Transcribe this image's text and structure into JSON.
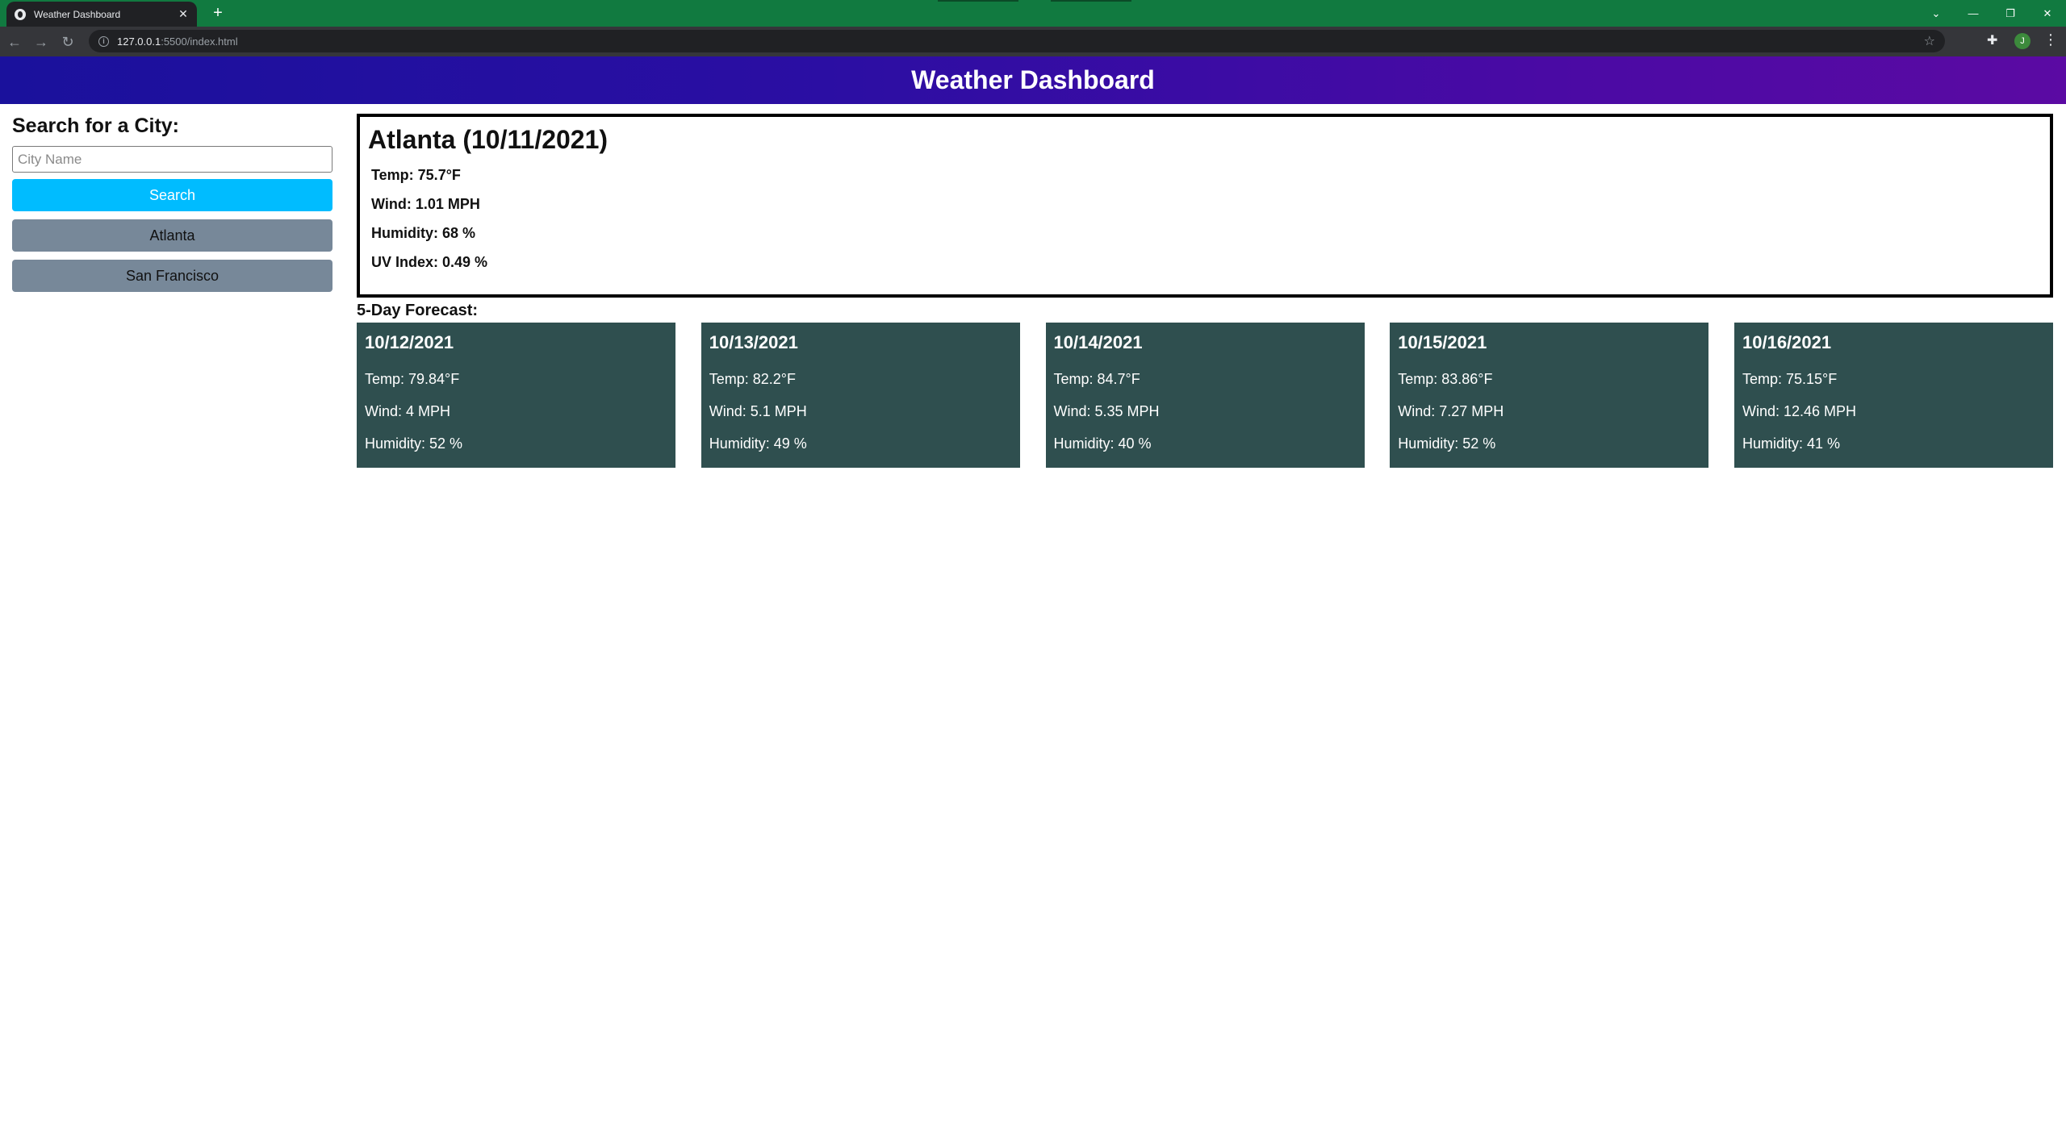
{
  "browser": {
    "tab_title": "Weather Dashboard",
    "url_host": "127.0.0.1",
    "url_path": ":5500/index.html",
    "profile_initial": "J"
  },
  "header": {
    "title": "Weather Dashboard"
  },
  "sidebar": {
    "heading": "Search for a City:",
    "input_placeholder": "City Name",
    "input_value": "",
    "search_label": "Search",
    "history": [
      "Atlanta",
      "San Francisco"
    ]
  },
  "current": {
    "title": "Atlanta (10/11/2021)",
    "temp": "Temp: 75.7°F",
    "wind": "Wind: 1.01 MPH",
    "humidity": "Humidity: 68 %",
    "uv": "UV Index: 0.49 %"
  },
  "forecast": {
    "heading": "5-Day Forecast:",
    "days": [
      {
        "date": "10/12/2021",
        "temp": "Temp: 79.84°F",
        "wind": "Wind: 4 MPH",
        "humidity": "Humidity: 52 %"
      },
      {
        "date": "10/13/2021",
        "temp": "Temp: 82.2°F",
        "wind": "Wind: 5.1 MPH",
        "humidity": "Humidity: 49 %"
      },
      {
        "date": "10/14/2021",
        "temp": "Temp: 84.7°F",
        "wind": "Wind: 5.35 MPH",
        "humidity": "Humidity: 40 %"
      },
      {
        "date": "10/15/2021",
        "temp": "Temp: 83.86°F",
        "wind": "Wind: 7.27 MPH",
        "humidity": "Humidity: 52 %"
      },
      {
        "date": "10/16/2021",
        "temp": "Temp: 75.15°F",
        "wind": "Wind: 12.46 MPH",
        "humidity": "Humidity: 41 %"
      }
    ]
  },
  "colors": {
    "header_gradient_start": "#1a119c",
    "header_gradient_end": "#5b0aa3",
    "search_button": "#00bcff",
    "history_button": "#778899",
    "forecast_card": "#2f4f4f",
    "browser_frame": "#117a40"
  },
  "icons": {
    "back": "arrow-left-icon",
    "forward": "arrow-right-icon",
    "reload": "reload-icon",
    "site_info": "info-icon",
    "bookmark": "star-icon",
    "extensions": "puzzle-icon",
    "menu": "kebab-menu-icon",
    "new_tab": "plus-icon",
    "tab_close": "close-icon"
  }
}
